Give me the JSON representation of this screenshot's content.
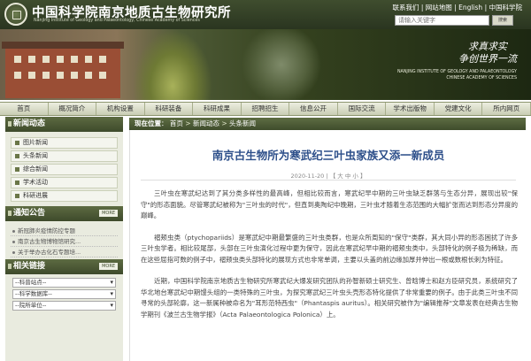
{
  "header": {
    "site_title": "中国科学院南京地质古生物研究所",
    "site_subtitle": "Nanjing Institute of Geology and Palaeontology, Chinese Academy of Sciences",
    "toplinks": [
      "联系我们",
      "网站地图",
      "English",
      "中国科学院"
    ],
    "toplink_sep": "|",
    "search_placeholder": "请输入关键字",
    "search_button": "搜索"
  },
  "banner": {
    "slogan_line1": "求真求实",
    "slogan_line2": "争创世界一流",
    "english_line1": "NANJING INSTITUTE OF GEOLOGY AND PALAEONTOLOGY",
    "english_line2": "CHINESE ACADEMY OF SCIENCES"
  },
  "nav": {
    "items": [
      "首页",
      "概况简介",
      "机构设置",
      "科研装备",
      "科研成果",
      "招聘招生",
      "信息公开",
      "国际交流",
      "学术出版物",
      "党建文化",
      "所内网页"
    ]
  },
  "sidebar": {
    "news_heading": "新闻动态",
    "news_items": [
      "图片新闻",
      "头条新闻",
      "综合新闻",
      "学术活动",
      "科研进展"
    ],
    "notice_heading": "通知公告",
    "more_label": "MORE",
    "notice_items": [
      "新冠肺炎疫情防控专题",
      "南京古生物博物馆研究...",
      "关于举办古化石专题培..."
    ],
    "links_heading": "相关链接",
    "link_selects": [
      "--科普站点--",
      "--科学数据库--",
      "--院所单位--"
    ]
  },
  "breadcrumb": {
    "label": "现在位置",
    "path": [
      "首页",
      "新闻动态",
      "头条新闻"
    ],
    "sep": ">"
  },
  "article": {
    "title": "南京古生物所为寒武纪三叶虫家族又添一新成员",
    "date": "2020-11-20",
    "meta_sep": "|",
    "font_label": "【 大 中 小 】",
    "paragraphs": [
      "三叶虫在寒武纪达到了其分类多样性的最高峰，但相比较而言，寒武纪早中期的三叶虫缺乏群落与生态分异，展现出较\"保守\"的形态面貌。尽管寒武纪被称为\"三叶虫的时代\"，但直到奥陶纪中晚期，三叶虫才随着生态范围的大幅扩张而达到形态分异度的巅峰。",
      "褶颊虫类（ptychopariids）是寒武纪中期最繁盛的三叶虫类群，也是众所周知的\"保守\"类群，其大同小异的形态困扰了许多三叶虫学者。相比较尾部，头部在三叶虫演化过程中更为保守，因此在寒武纪早中期的褶颊虫类中，头部特化的例子极为稀缺，而在这些屈指可数的例子中，褶颊虫类头部特化的展现方式也非常单调，主要以头盖的前边缘加厚并伸出一根或数根长刺为特征。",
      "近期，中国科学院南京地质古生物研究所寒武纪大爆发研究团队的孙智新硕士研究生、曾晗博士和赵方臣研究员，系统研究了华北地台寒武纪中期馒头组的一类特殊的三叶虫，为探究寒武纪三叶虫头壳形态特化提供了非常重要的例子。由于此类三叶虫不同寻常的头部轮廓，这一新属种被命名为\"耳形范特西虫\"（Phantaspis auritus）。相关研究被作为\"编辑推荐\"文章发表在经典古生物学期刊《波兰古生物学报》（Acta Palaeontologica Polonica）上。"
    ]
  },
  "colors": {
    "header_bg": "#3f4d2e",
    "nav_bg": "#dfe2cf",
    "sidebar_bg": "#e9ebdf",
    "title_blue": "#2d4f8a"
  }
}
